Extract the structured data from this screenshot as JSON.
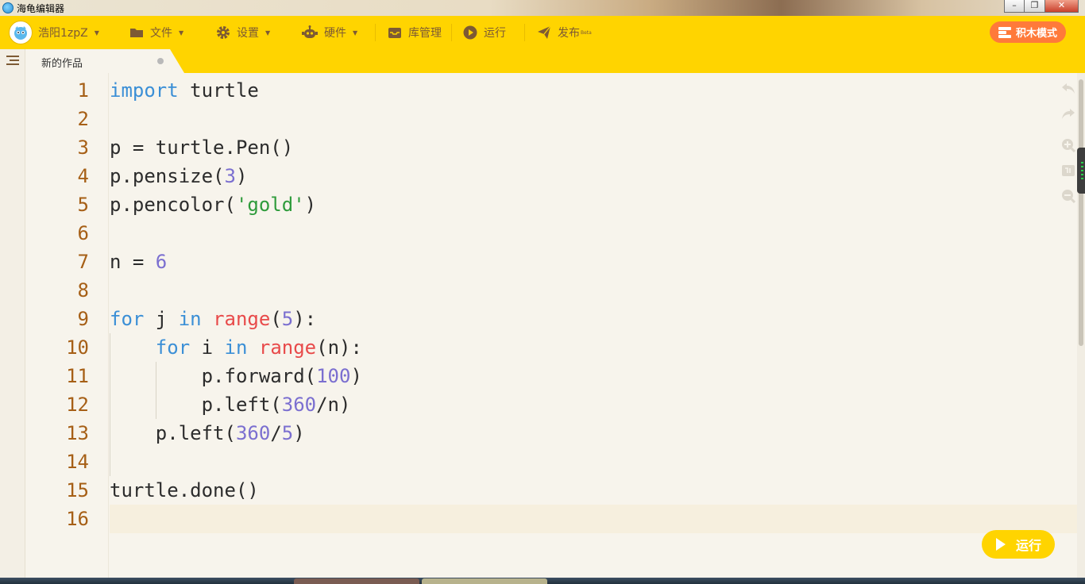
{
  "window": {
    "title": "海龟编辑器"
  },
  "toolbar": {
    "user": "浩阳1zpZ",
    "file": "文件",
    "settings": "设置",
    "hardware": "硬件",
    "library": "库管理",
    "run": "运行",
    "publish": "发布",
    "publish_badge": "Beta",
    "block_mode": "积木模式"
  },
  "tab": {
    "label": "新的作品"
  },
  "editor": {
    "line_numbers": [
      "1",
      "2",
      "3",
      "4",
      "5",
      "6",
      "7",
      "8",
      "9",
      "10",
      "11",
      "12",
      "13",
      "14",
      "15",
      "16"
    ],
    "lines": [
      [
        {
          "t": "import",
          "c": "kw"
        },
        {
          "t": " turtle",
          "c": ""
        }
      ],
      [],
      [
        {
          "t": "p = turtle.Pen()",
          "c": ""
        }
      ],
      [
        {
          "t": "p.pensize(",
          "c": ""
        },
        {
          "t": "3",
          "c": "num"
        },
        {
          "t": ")",
          "c": ""
        }
      ],
      [
        {
          "t": "p.pencolor(",
          "c": ""
        },
        {
          "t": "'gold'",
          "c": "str"
        },
        {
          "t": ")",
          "c": ""
        }
      ],
      [],
      [
        {
          "t": "n = ",
          "c": ""
        },
        {
          "t": "6",
          "c": "num"
        }
      ],
      [],
      [
        {
          "t": "for",
          "c": "kw"
        },
        {
          "t": " j ",
          "c": ""
        },
        {
          "t": "in",
          "c": "kw"
        },
        {
          "t": " ",
          "c": ""
        },
        {
          "t": "range",
          "c": "bi"
        },
        {
          "t": "(",
          "c": ""
        },
        {
          "t": "5",
          "c": "num"
        },
        {
          "t": "):",
          "c": ""
        }
      ],
      [
        {
          "t": "    ",
          "c": ""
        },
        {
          "t": "for",
          "c": "kw"
        },
        {
          "t": " i ",
          "c": ""
        },
        {
          "t": "in",
          "c": "kw"
        },
        {
          "t": " ",
          "c": ""
        },
        {
          "t": "range",
          "c": "bi"
        },
        {
          "t": "(n):",
          "c": ""
        }
      ],
      [
        {
          "t": "        p.forward(",
          "c": ""
        },
        {
          "t": "100",
          "c": "num"
        },
        {
          "t": ")",
          "c": ""
        }
      ],
      [
        {
          "t": "        p.left(",
          "c": ""
        },
        {
          "t": "360",
          "c": "num"
        },
        {
          "t": "/n)",
          "c": ""
        }
      ],
      [
        {
          "t": "    p.left(",
          "c": ""
        },
        {
          "t": "360",
          "c": "num"
        },
        {
          "t": "/",
          "c": ""
        },
        {
          "t": "5",
          "c": "num"
        },
        {
          "t": ")",
          "c": ""
        }
      ],
      [],
      [
        {
          "t": "turtle.done()",
          "c": ""
        }
      ],
      []
    ]
  },
  "run_button": {
    "label": "运行"
  },
  "colors": {
    "toolbar": "#ffd400",
    "block_mode": "#ff7a3a",
    "keyword": "#3b8fd6",
    "builtin": "#e84a4a",
    "number": "#7b6fd0",
    "string": "#2e9b3b"
  }
}
